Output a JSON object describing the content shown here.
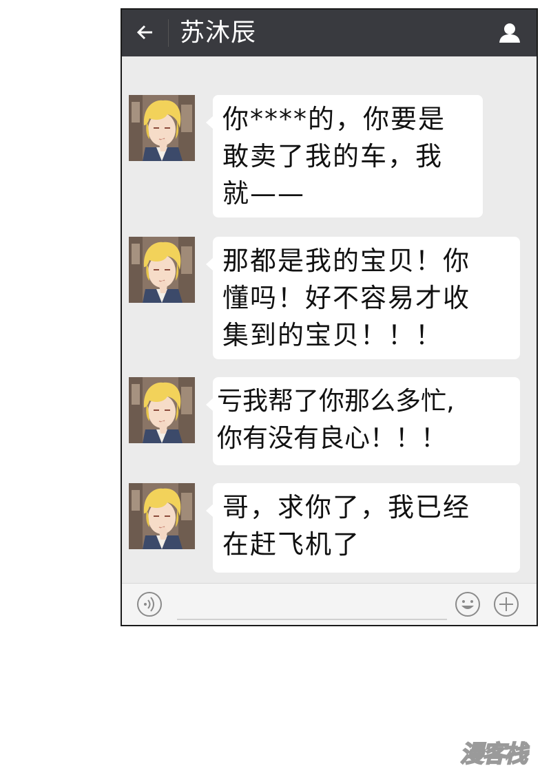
{
  "chat": {
    "title": "苏沐辰",
    "messages": [
      {
        "text": "你****的，你要是\n敢卖了我的车，我\n就——"
      },
      {
        "text": "那都是我的宝贝！你\n懂吗！好不容易才收\n集到的宝贝！！！"
      },
      {
        "text": "亏我帮了你那么多忙,\n你有没有良心！！！"
      },
      {
        "text": "哥，求你了，我已经\n在赶飞机了"
      }
    ]
  },
  "icons": {
    "back": "back-arrow-icon",
    "profile": "person-icon",
    "voice": "voice-icon",
    "emoji": "emoji-icon",
    "plus": "plus-icon"
  },
  "watermark": {
    "text": "漫客栈"
  },
  "colors": {
    "topbar": "#393a3f",
    "chat_bg": "#ebebeb",
    "bubble": "#ffffff",
    "hair": "#f2d25a"
  }
}
